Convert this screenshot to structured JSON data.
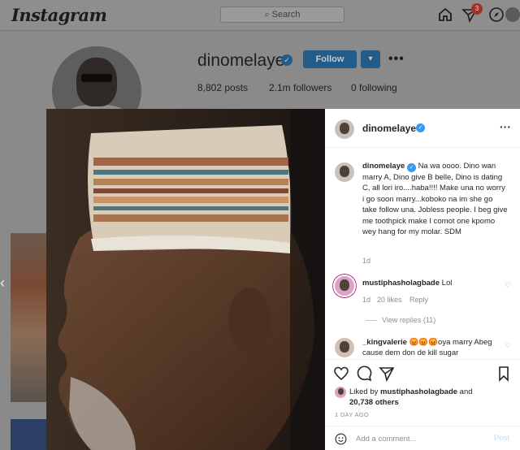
{
  "topbar": {
    "logo": "Instagram",
    "search_placeholder": "Search",
    "notification_count": "3"
  },
  "profile": {
    "username": "dinomelaye",
    "follow_label": "Follow",
    "posts": "8,802 posts",
    "followers": "2.1m followers",
    "following": "0 following"
  },
  "post": {
    "header_username": "dinomelaye",
    "caption_username": "dinomelaye",
    "caption_text": "Na wa oooo. Dino wan marry A, Dino give B belle, Dino is dating C, all lori iro....haba!!!! Make una no worry i go soon marry...koboko na im she go take follow una. Jobless people. I beg give me toothpick make I comot one kpomo wey hang for my molar. SDM",
    "caption_time": "1d",
    "comments": [
      {
        "username": "mustiphasholagbade",
        "text": "Lol",
        "time": "1d",
        "likes": "20 likes",
        "reply": "Reply",
        "view_replies": "View replies (11)"
      },
      {
        "username": "_kingvalerie",
        "text": "😡😡😡oya marry Abeg cause dem don de kill sugar"
      }
    ],
    "liked_by_prefix": "Liked by ",
    "liked_by_user": "mustiphasholagbade",
    "liked_by_and": " and",
    "liked_by_others": "20,738 others",
    "date": "1 DAY AGO",
    "add_comment_placeholder": "Add a comment...",
    "post_label": "Post"
  },
  "colors": {
    "accent_blue": "#3897f0",
    "post_disabled": "#b2dffc",
    "notif_red": "#ed4956"
  }
}
